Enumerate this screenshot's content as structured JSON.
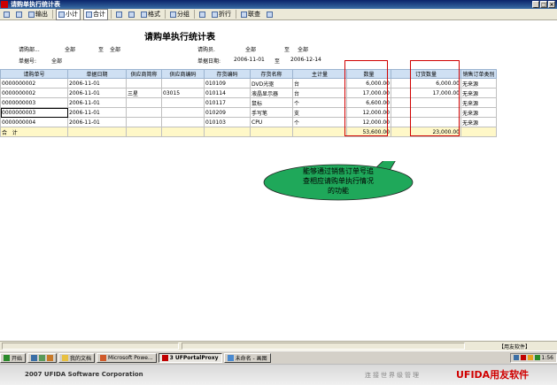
{
  "window": {
    "title": "请购单执行统计表",
    "controls": [
      "_",
      "□",
      "×"
    ]
  },
  "toolbar": {
    "items": [
      "",
      "",
      "输出",
      "小计",
      "合计",
      "",
      "",
      "格式",
      "分组",
      "",
      "折行",
      "",
      "联查",
      ""
    ]
  },
  "report": {
    "title": "请购单执行统计表",
    "filters": {
      "dept_label": "请购部...",
      "dept_from": "全部",
      "dept_to_label": "至",
      "dept_to": "全部",
      "staff_label": "请购员.",
      "staff_from": "全部",
      "staff_to_label": "至",
      "staff_to": "全部",
      "doctype_label": "单据号:",
      "doctype_value": "全部",
      "date_label": "单据日期:",
      "date_from": "2006-11-01",
      "date_to_label": "至",
      "date_to": "2006-12-14"
    },
    "columns": [
      "请购单号",
      "单据日期",
      "供应商简称",
      "供应商编码",
      "存货编码",
      "存货名称",
      "主计量",
      "数量",
      "订货数量",
      "销售订单类别"
    ],
    "rows": [
      [
        "0000000002",
        "2006-11-01",
        "",
        "",
        "010109",
        "DVD光驱",
        "台",
        "6,000.00",
        "6,000.00",
        "无来源"
      ],
      [
        "0000000002",
        "2006-11-01",
        "三星",
        "03015",
        "010114",
        "液晶显示器",
        "台",
        "17,000.00",
        "17,000.00",
        "无来源"
      ],
      [
        "0000000003",
        "2006-11-01",
        "",
        "",
        "010117",
        "鼠标",
        "个",
        "6,600.00",
        "",
        "无来源"
      ],
      [
        "0000000003",
        "2006-11-01",
        "",
        "",
        "010209",
        "手写笔",
        "支",
        "12,000.00",
        "",
        "无来源"
      ],
      [
        "0000000004",
        "2006-11-01",
        "",
        "",
        "010103",
        "CPU",
        "个",
        "12,000.00",
        "",
        "无来源"
      ]
    ],
    "total": [
      "合",
      "计",
      "",
      "",
      "",
      "",
      "",
      "53,600.00",
      "23,000.00",
      ""
    ]
  },
  "callout": {
    "lines": [
      "能够通过销售订单号追",
      "查相应请购单执行情况",
      "的功能"
    ],
    "fill": "#1fa85a"
  },
  "statusbar": {
    "text": "【用友软件】"
  },
  "taskbar": {
    "start": "开始",
    "tasks": [
      "我的文档",
      "Microsoft Powe...",
      "3 UFPortalProxy",
      "未命名 - 画图"
    ],
    "time": "1:56"
  },
  "footer": {
    "corp": "2007 UFIDA Software Corporation",
    "slogan": "连接世界级管理",
    "logo": "UFIDA用友软件"
  },
  "colors": {
    "header_bg": "#cfe0f3",
    "total_bg": "#fff8c8",
    "highlight_box": "#d00000",
    "titlebar": "#0a246a"
  }
}
